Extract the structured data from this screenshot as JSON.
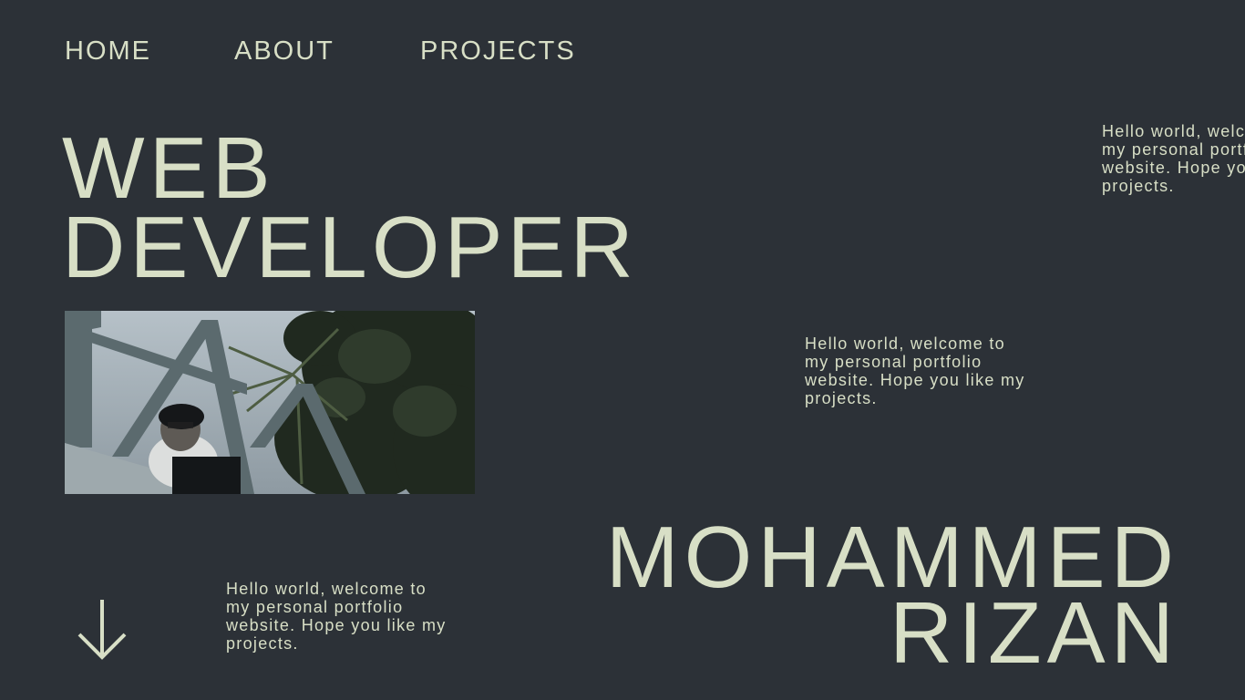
{
  "nav": {
    "home": "HOME",
    "about": "ABOUT",
    "projects": "PROJECTS"
  },
  "hero": {
    "line1": "WEB",
    "line2": "DEVELOPER"
  },
  "intro": {
    "text": "Hello world, welcome to my personal portfolio website. Hope you like my projects."
  },
  "name": {
    "first": "MOHAMMED",
    "last": "RIZAN"
  },
  "icons": {
    "scroll": "arrow-down-icon"
  },
  "colors": {
    "background": "#2c3137",
    "text": "#d8dfc6"
  }
}
